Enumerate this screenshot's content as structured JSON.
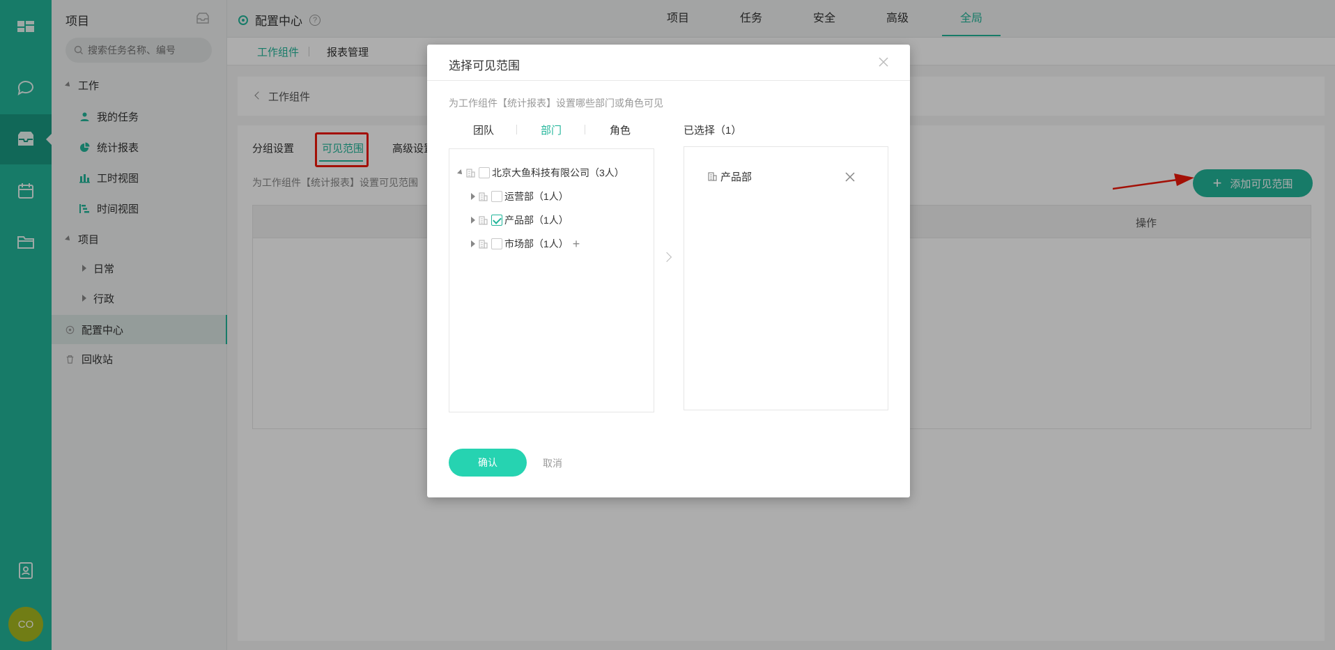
{
  "rail": {
    "icons": [
      "dashboard-icon",
      "chat-icon",
      "inbox-icon",
      "calendar-icon",
      "folder-icon",
      "contacts-icon"
    ],
    "avatar_text": "CO"
  },
  "sidebar": {
    "title": "项目",
    "search_placeholder": "搜索任务名称、编号",
    "groups": [
      {
        "label": "工作",
        "items": [
          {
            "label": "我的任务",
            "icon": "user-icon"
          },
          {
            "label": "统计报表",
            "icon": "pie-chart-icon"
          },
          {
            "label": "工时视图",
            "icon": "bar-chart-icon"
          },
          {
            "label": "时间视图",
            "icon": "gantt-icon"
          }
        ]
      },
      {
        "label": "项目",
        "items": [
          {
            "label": "日常"
          },
          {
            "label": "行政"
          }
        ]
      }
    ],
    "config_center": "配置中心",
    "recycle_bin": "回收站"
  },
  "topbar": {
    "title": "配置中心",
    "help": "?",
    "tabs": [
      "项目",
      "任务",
      "安全",
      "高级",
      "全局"
    ],
    "active_tab": "全局"
  },
  "subbar": {
    "tabs": [
      "工作组件",
      "报表管理"
    ]
  },
  "content": {
    "breadcrumb": "工作组件",
    "tabs": [
      "分组设置",
      "可见范围",
      "高级设置"
    ],
    "hint": "为工作组件【统计报表】设置可见范围",
    "add_button": "添加可见范围",
    "table_header_op": "操作"
  },
  "modal": {
    "title": "选择可见范围",
    "description": "为工作组件【统计报表】设置哪些部门或角色可见",
    "tabs": [
      "团队",
      "部门",
      "角色"
    ],
    "active_tab": "部门",
    "selected_count": "已选择（1）",
    "tree": {
      "root": "北京大鱼科技有限公司（3人）",
      "children": [
        {
          "label": "运营部（1人）",
          "checked": false
        },
        {
          "label": "产品部（1人）",
          "checked": true
        },
        {
          "label": "市场部（1人）",
          "checked": false
        }
      ]
    },
    "selected": [
      "产品部"
    ],
    "confirm": "确认",
    "cancel": "取消"
  },
  "colors": {
    "brand": "#22b59a",
    "confirm": "#26d3b1",
    "highlight": "#f1190a"
  }
}
